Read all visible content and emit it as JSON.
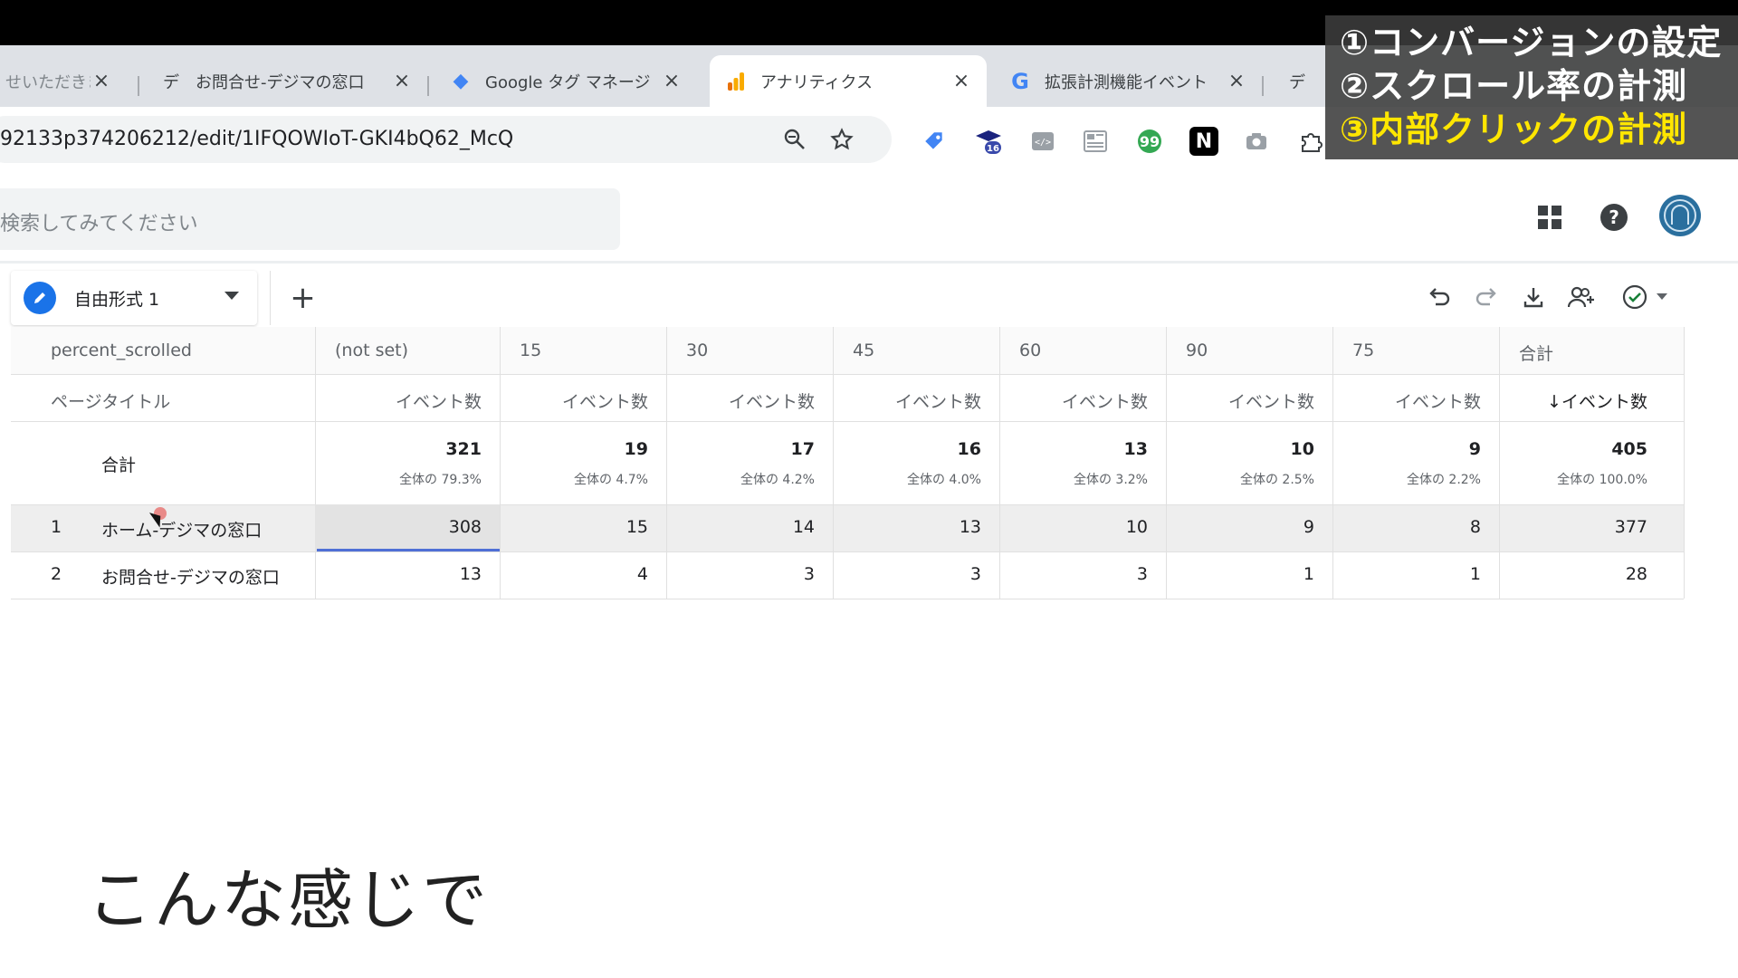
{
  "browser": {
    "tabs": [
      {
        "title": "せいただきま",
        "icon": "doc-favicon",
        "close": "×"
      },
      {
        "title": "お問合せ-デジマの窓口",
        "icon": "de-favicon",
        "glyph": "デ",
        "close": "×"
      },
      {
        "title": "Google タグ マネージ",
        "icon": "gtm-favicon",
        "glyph": "◆",
        "close": "×"
      },
      {
        "title": "アナリティクス",
        "icon": "analytics-favicon",
        "close": "×"
      },
      {
        "title": "拡張計測機能イベント",
        "icon": "google-favicon",
        "glyph": "G",
        "close": "×"
      },
      {
        "title": "デ",
        "icon": "de-favicon",
        "glyph": "デ",
        "close": ""
      }
    ],
    "url": "92133p374206212/edit/1IFQOWIoT-GKI4bQ62_McQ",
    "extensions": [
      "tag-icon",
      "cap-icon",
      "code-icon",
      "layout-icon",
      "quote-icon",
      "notion-icon",
      "camera-icon",
      "puzzle-icon"
    ],
    "ext_badge": "16",
    "notion_glyph": "N"
  },
  "overlay": {
    "lines": [
      "①コンバージョンの設定",
      "②スクロール率の計測",
      "③内部クリックの計測"
    ]
  },
  "app": {
    "search_placeholder": "検索してみてください",
    "tab_label": "自由形式 1",
    "add_tab": "+",
    "table": {
      "dim1_name": "percent_scrolled",
      "dim2_name": "ページタイトル",
      "columns": [
        "(not set)",
        "15",
        "30",
        "45",
        "60",
        "90",
        "75",
        "合計"
      ],
      "metric_label": "イベント数",
      "sorted_metric_label": "↓イベント数",
      "totals_label": "合計",
      "totals": [
        "321",
        "19",
        "17",
        "16",
        "13",
        "10",
        "9",
        "405"
      ],
      "totals_pct": [
        "全体の 79.3%",
        "全体の 4.7%",
        "全体の 4.2%",
        "全体の 4.0%",
        "全体の 3.2%",
        "全体の 2.5%",
        "全体の 2.2%",
        "全体の 100.0%"
      ],
      "rows": [
        {
          "index": "1",
          "title": "ホーム-デジマの窓口",
          "values": [
            "308",
            "15",
            "14",
            "13",
            "10",
            "9",
            "8",
            "377"
          ]
        },
        {
          "index": "2",
          "title": "お問合せ-デジマの窓口",
          "values": [
            "13",
            "4",
            "3",
            "3",
            "3",
            "1",
            "1",
            "28"
          ]
        }
      ]
    }
  },
  "caption": "こんな感じで"
}
